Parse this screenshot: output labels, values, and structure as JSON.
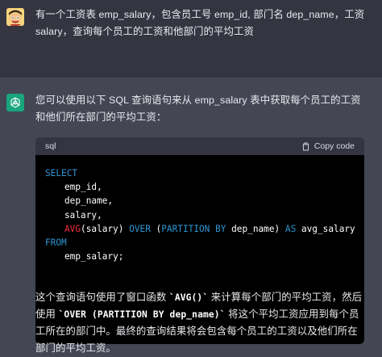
{
  "user": {
    "avatar": "cartoon-avatar-icon",
    "message": "有一个工资表 emp_salary，包含员工号 emp_id, 部门名 dep_name，工资 salary，查询每个员工的工资和他部门的平均工资"
  },
  "assistant": {
    "avatar": "openai-logo-icon",
    "intro": "您可以使用以下 SQL 查询语句来从 emp_salary 表中获取每个员工的工资和他们所在部门的平均工资：",
    "code": {
      "language": "sql",
      "copy_label": "Copy code",
      "lines": [
        {
          "type": "kw",
          "text": "SELECT"
        },
        {
          "type": "plain",
          "indent": true,
          "text": "emp_id,"
        },
        {
          "type": "plain",
          "indent": true,
          "text": "dep_name,"
        },
        {
          "type": "plain",
          "indent": true,
          "text": "salary,"
        },
        {
          "type": "avg",
          "indent": true,
          "fn": "AVG",
          "fn_arg": "(salary) ",
          "kw1": "OVER",
          "mid": " (",
          "kw2": "PARTITION",
          "sp": " ",
          "kw3": "BY",
          "rest": " dep_name) ",
          "kw4": "AS",
          "tail": " avg_salary"
        },
        {
          "type": "kw",
          "text": "FROM"
        },
        {
          "type": "plain",
          "indent": true,
          "text": "emp_salary;"
        }
      ]
    },
    "outro": {
      "p1": "这个查询语句使用了窗口函数 ",
      "c1": "`AVG()`",
      "p2": " 来计算每个部门的平均工资，然后使用 ",
      "c2": "`OVER (PARTITION BY dep_name)`",
      "p3": " 将这个平均工资应用到每个员工所在的部门中。最终的查询结果将会包含每个员工的工资以及他们所在部门的平均工资。"
    }
  },
  "colors": {
    "user_bg": "#343541",
    "assistant_bg": "#444654",
    "code_bg": "#000000",
    "code_head_bg": "#343541",
    "keyword": "#2e95d3",
    "function": "#f22c3d",
    "gpt_green": "#19a57e"
  }
}
